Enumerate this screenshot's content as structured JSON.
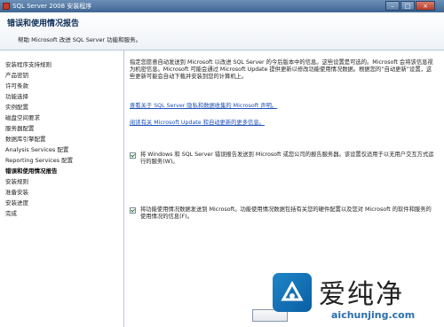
{
  "window": {
    "title": "SQL Server 2008 安装程序"
  },
  "header": {
    "title": "错误和使用情况报告",
    "subtitle": "帮助 Microsoft 改进 SQL Server 功能和服务。"
  },
  "sidebar": {
    "items": [
      {
        "label": "安装程序支持规则",
        "active": false
      },
      {
        "label": "产品密钥",
        "active": false
      },
      {
        "label": "许可条款",
        "active": false
      },
      {
        "label": "功能选择",
        "active": false
      },
      {
        "label": "实例配置",
        "active": false
      },
      {
        "label": "磁盘空间要求",
        "active": false
      },
      {
        "label": "服务器配置",
        "active": false
      },
      {
        "label": "数据库引擎配置",
        "active": false
      },
      {
        "label": "Analysis Services 配置",
        "active": false
      },
      {
        "label": "Reporting Services 配置",
        "active": false
      },
      {
        "label": "错误和使用情况报告",
        "active": true
      },
      {
        "label": "安装规则",
        "active": false
      },
      {
        "label": "准备安装",
        "active": false
      },
      {
        "label": "安装进度",
        "active": false
      },
      {
        "label": "完成",
        "active": false
      }
    ]
  },
  "main": {
    "intro": "指定您愿意自动发送到 Microsoft 以改进 SQL Server 的今后版本中的信息。这些设置是可选的。Microsoft 会将该信息视为机密信息。Microsoft 可能会通过 Microsoft Update 提供更新以修改功能使用情况数据。根据您的“自动更新”设置，这些更新可能会自动下载并安装到您的计算机上。",
    "link1": "查看关于 SQL Server 隐私和数据收集的 Microsoft 声明。",
    "link2": "阅读有关 Microsoft Update 和自动更新的更多信息。",
    "checkbox1": {
      "label": "将 Windows 和 SQL Server 错误报告发送到 Microsoft 或您公司的报告服务器。该设置仅适用于以无用户交互方式运行的服务(W)。",
      "checked": true
    },
    "checkbox2": {
      "label": "将功能使用情况数据发送到 Microsoft。功能使用情况数据包括有关您的硬件配置以及您对 Microsoft 的软件和服务的使用情况的信息(F)。",
      "checked": true
    }
  },
  "watermark": {
    "text": "爱纯净",
    "url": "aichunjing.com"
  }
}
